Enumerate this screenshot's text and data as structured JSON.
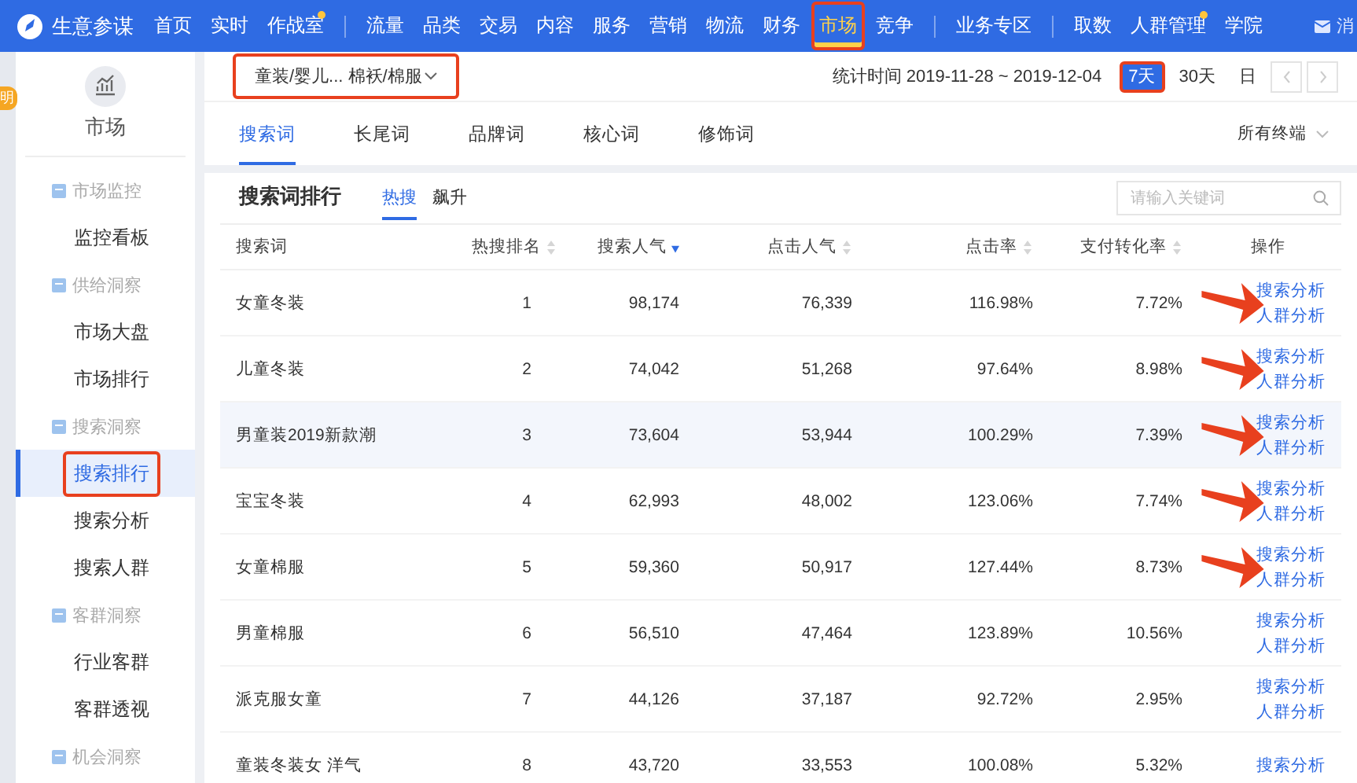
{
  "topnav": {
    "brand": "生意参谋",
    "groups": [
      [
        {
          "label": "首页",
          "selected": false,
          "dot": false,
          "annotated": false
        },
        {
          "label": "实时",
          "selected": false,
          "dot": false,
          "annotated": false
        },
        {
          "label": "作战室",
          "selected": false,
          "dot": true,
          "annotated": false
        }
      ],
      [
        {
          "label": "流量",
          "selected": false,
          "dot": false,
          "annotated": false
        },
        {
          "label": "品类",
          "selected": false,
          "dot": false,
          "annotated": false
        },
        {
          "label": "交易",
          "selected": false,
          "dot": false,
          "annotated": false
        },
        {
          "label": "内容",
          "selected": false,
          "dot": false,
          "annotated": false
        },
        {
          "label": "服务",
          "selected": false,
          "dot": false,
          "annotated": false
        },
        {
          "label": "营销",
          "selected": false,
          "dot": false,
          "annotated": false
        },
        {
          "label": "物流",
          "selected": false,
          "dot": false,
          "annotated": false
        },
        {
          "label": "财务",
          "selected": false,
          "dot": false,
          "annotated": false
        },
        {
          "label": "市场",
          "selected": true,
          "dot": false,
          "annotated": true
        },
        {
          "label": "竞争",
          "selected": false,
          "dot": false,
          "annotated": false
        }
      ],
      [
        {
          "label": "业务专区",
          "selected": false,
          "dot": false,
          "annotated": false
        }
      ],
      [
        {
          "label": "取数",
          "selected": false,
          "dot": false,
          "annotated": false
        },
        {
          "label": "人群管理",
          "selected": false,
          "dot": true,
          "annotated": false
        },
        {
          "label": "学院",
          "selected": false,
          "dot": false,
          "annotated": false
        }
      ]
    ],
    "messages": "消"
  },
  "help_badge": "明",
  "sidebar": {
    "title": "市场",
    "items": [
      {
        "kind": "group",
        "label": "市场监控"
      },
      {
        "kind": "link",
        "label": "监控看板",
        "selected": false,
        "annotated": false
      },
      {
        "kind": "group",
        "label": "供给洞察"
      },
      {
        "kind": "link",
        "label": "市场大盘",
        "selected": false,
        "annotated": false
      },
      {
        "kind": "link",
        "label": "市场排行",
        "selected": false,
        "annotated": false
      },
      {
        "kind": "group",
        "label": "搜索洞察"
      },
      {
        "kind": "link",
        "label": "搜索排行",
        "selected": true,
        "annotated": true
      },
      {
        "kind": "link",
        "label": "搜索分析",
        "selected": false,
        "annotated": false
      },
      {
        "kind": "link",
        "label": "搜索人群",
        "selected": false,
        "annotated": false
      },
      {
        "kind": "group",
        "label": "客群洞察"
      },
      {
        "kind": "link",
        "label": "行业客群",
        "selected": false,
        "annotated": false
      },
      {
        "kind": "link",
        "label": "客群透视",
        "selected": false,
        "annotated": false
      },
      {
        "kind": "group",
        "label": "机会洞察"
      }
    ]
  },
  "category": {
    "value": "童装/婴儿... 棉袄/棉服",
    "annotated": true
  },
  "period": {
    "label": "统计时间 2019-11-28 ~ 2019-12-04",
    "buttons": [
      {
        "label": "7天",
        "selected": true,
        "annotated": true
      },
      {
        "label": "30天",
        "selected": false,
        "annotated": false
      },
      {
        "label": "日",
        "selected": false,
        "annotated": false
      }
    ]
  },
  "tabs": [
    {
      "label": "搜索词",
      "selected": true
    },
    {
      "label": "长尾词",
      "selected": false
    },
    {
      "label": "品牌词",
      "selected": false
    },
    {
      "label": "核心词",
      "selected": false
    },
    {
      "label": "修饰词",
      "selected": false
    }
  ],
  "terminal": "所有终端",
  "card": {
    "title": "搜索词排行",
    "subtabs": [
      {
        "label": "热搜",
        "selected": true
      },
      {
        "label": "飙升",
        "selected": false
      }
    ],
    "search": {
      "placeholder": "请输入关键词"
    }
  },
  "table": {
    "columns": [
      {
        "label": "搜索词",
        "sortable": false,
        "sorted": false
      },
      {
        "label": "热搜排名",
        "sortable": true,
        "sorted": false
      },
      {
        "label": "搜索人气",
        "sortable": true,
        "sorted": true
      },
      {
        "label": "点击人气",
        "sortable": true,
        "sorted": false
      },
      {
        "label": "点击率",
        "sortable": true,
        "sorted": false
      },
      {
        "label": "支付转化率",
        "sortable": true,
        "sorted": false
      },
      {
        "label": "操作",
        "sortable": false,
        "sorted": false
      }
    ],
    "rows": [
      {
        "cells": [
          "女童冬装",
          "1",
          "98,174",
          "76,339",
          "116.98%",
          "7.72%"
        ],
        "actions": [
          "搜索分析",
          "人群分析"
        ],
        "hovered": false,
        "arrow": true
      },
      {
        "cells": [
          "儿童冬装",
          "2",
          "74,042",
          "51,268",
          "97.64%",
          "8.98%"
        ],
        "actions": [
          "搜索分析",
          "人群分析"
        ],
        "hovered": false,
        "arrow": true
      },
      {
        "cells": [
          "男童装2019新款潮",
          "3",
          "73,604",
          "53,944",
          "100.29%",
          "7.39%"
        ],
        "actions": [
          "搜索分析",
          "人群分析"
        ],
        "hovered": true,
        "arrow": true
      },
      {
        "cells": [
          "宝宝冬装",
          "4",
          "62,993",
          "48,002",
          "123.06%",
          "7.74%"
        ],
        "actions": [
          "搜索分析",
          "人群分析"
        ],
        "hovered": false,
        "arrow": true
      },
      {
        "cells": [
          "女童棉服",
          "5",
          "59,360",
          "50,917",
          "127.44%",
          "8.73%"
        ],
        "actions": [
          "搜索分析",
          "人群分析"
        ],
        "hovered": false,
        "arrow": true
      },
      {
        "cells": [
          "男童棉服",
          "6",
          "56,510",
          "47,464",
          "123.89%",
          "10.56%"
        ],
        "actions": [
          "搜索分析",
          "人群分析"
        ],
        "hovered": false,
        "arrow": false
      },
      {
        "cells": [
          "派克服女童",
          "7",
          "44,126",
          "37,187",
          "92.72%",
          "2.95%"
        ],
        "actions": [
          "搜索分析",
          "人群分析"
        ],
        "hovered": false,
        "arrow": false
      },
      {
        "cells": [
          "童装冬装女 洋气",
          "8",
          "43,720",
          "33,553",
          "100.08%",
          "5.32%"
        ],
        "actions": [
          "搜索分析"
        ],
        "hovered": false,
        "arrow": false
      }
    ]
  }
}
